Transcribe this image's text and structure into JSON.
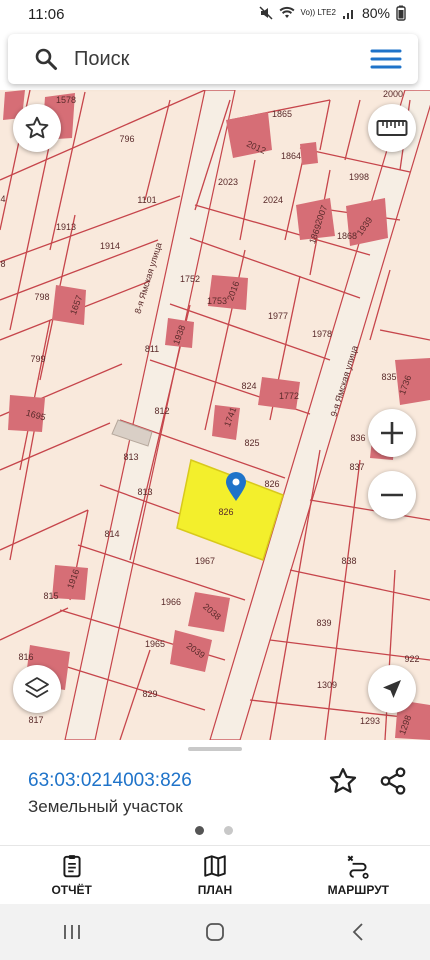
{
  "status": {
    "time": "11:06",
    "network": "Vo)) LTE2",
    "battery": "80%"
  },
  "search": {
    "placeholder": "Поиск"
  },
  "map": {
    "street_1": "8-я Ямская улица",
    "street_2": "9-я Ямская улица",
    "selected_parcel": "826",
    "parcels": [
      "1578",
      "796",
      "1865",
      "2000",
      "2012",
      "1864",
      "1998",
      "1101",
      "2023",
      "2024",
      "1869",
      "1868",
      "1939",
      "1913",
      "1914",
      "1752",
      "2016",
      "1753",
      "1977",
      "1978",
      "798",
      "1657",
      "811",
      "1938",
      "799",
      "824",
      "1772",
      "835",
      "1736",
      "1695",
      "812",
      "1741",
      "825",
      "836",
      "813",
      "837",
      "813",
      "826",
      "814",
      "1967",
      "838",
      "815",
      "1916",
      "1966",
      "2038",
      "839",
      "1965",
      "2039",
      "922",
      "816",
      "829",
      "1309",
      "817",
      "1293",
      "1298",
      "2007",
      "4",
      "8"
    ]
  },
  "sheet": {
    "cadastral_number": "63:03:0214003:826",
    "object_type": "Земельный участок"
  },
  "nav": {
    "report": "ОТЧЁТ",
    "plan": "ПЛАН",
    "route": "МАРШРУТ"
  },
  "colors": {
    "accent": "#1f73c9",
    "parcel_line": "#c6454b",
    "building": "#d66e76",
    "selected_fill": "#f3ef2c",
    "map_bg": "#f9e9dc"
  },
  "icons": [
    "search-icon",
    "menu-icon",
    "star-icon",
    "ruler-icon",
    "layers-icon",
    "zoom-in-icon",
    "zoom-out-icon",
    "locate-icon",
    "map-pin-icon",
    "share-icon",
    "report-icon",
    "plan-icon",
    "route-icon"
  ]
}
